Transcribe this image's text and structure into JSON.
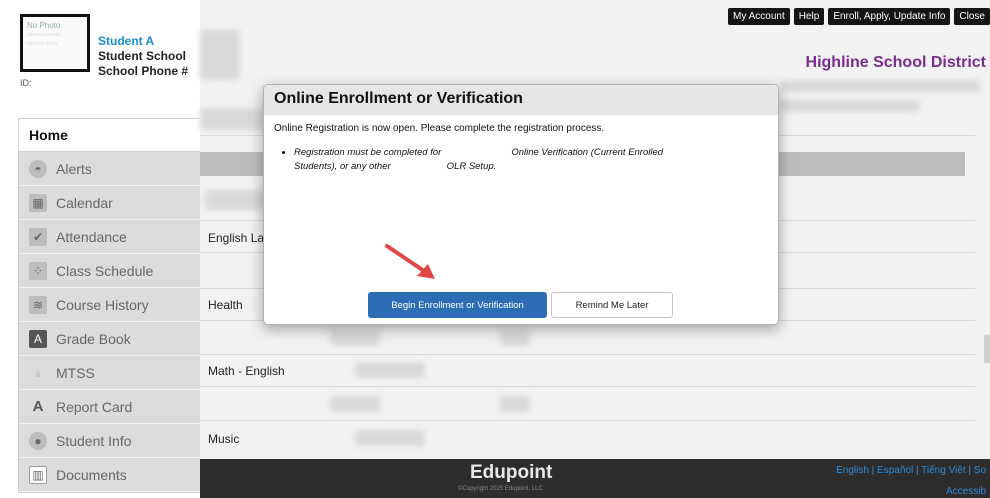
{
  "student": {
    "photo_label": "No Photo",
    "name": "Student A",
    "school": "Student School",
    "phone": "School Phone #",
    "id_label": "ID:"
  },
  "nav": {
    "home": "Home",
    "items": [
      {
        "label": "Alerts",
        "icon": "alerts-icon",
        "glyph": "◓"
      },
      {
        "label": "Calendar",
        "icon": "calendar-icon",
        "glyph": "▦"
      },
      {
        "label": "Attendance",
        "icon": "attendance-icon",
        "glyph": "✔"
      },
      {
        "label": "Class Schedule",
        "icon": "class-schedule-icon",
        "glyph": "⁘"
      },
      {
        "label": "Course History",
        "icon": "course-history-icon",
        "glyph": "≋"
      },
      {
        "label": "Grade Book",
        "icon": "grade-book-icon",
        "glyph": "A"
      },
      {
        "label": "MTSS",
        "icon": "mtss-icon",
        "glyph": "▲"
      },
      {
        "label": "Report Card",
        "icon": "report-card-icon",
        "glyph": "A"
      },
      {
        "label": "Student Info",
        "icon": "student-info-icon",
        "glyph": "●"
      },
      {
        "label": "Documents",
        "icon": "documents-icon",
        "glyph": "▥"
      }
    ]
  },
  "header": {
    "links": [
      "My Account",
      "Help",
      "Enroll, Apply, Update Info",
      "Close"
    ],
    "district": "Highline School District"
  },
  "table": {
    "rows": [
      "English La",
      "Health",
      "Math - English",
      "Music"
    ]
  },
  "modal": {
    "title": "Online Enrollment or Verification",
    "intro": "Online Registration is now open. Please complete the registration process.",
    "bullet_part1": "Registration must be completed for",
    "bullet_part2": "Online Verification (Current Enrolled",
    "bullet_part3": "Students), or any other",
    "bullet_part4": "OLR Setup.",
    "primary_button": "Begin Enrollment or Verification",
    "secondary_button": "Remind Me Later"
  },
  "footer": {
    "logo": "Edupoint",
    "copyright": "©Copyright 2025 Edupoint, LLC",
    "languages": "English  |  Español  |  Tiếng Việt  |  So",
    "accessibility": "Accessib"
  },
  "colors": {
    "student_name": "#1d8fcf",
    "district": "#7b2d8e",
    "primary_button": "#2c6db5",
    "footer": "#2d2d2d",
    "arrow": "#e04848"
  }
}
